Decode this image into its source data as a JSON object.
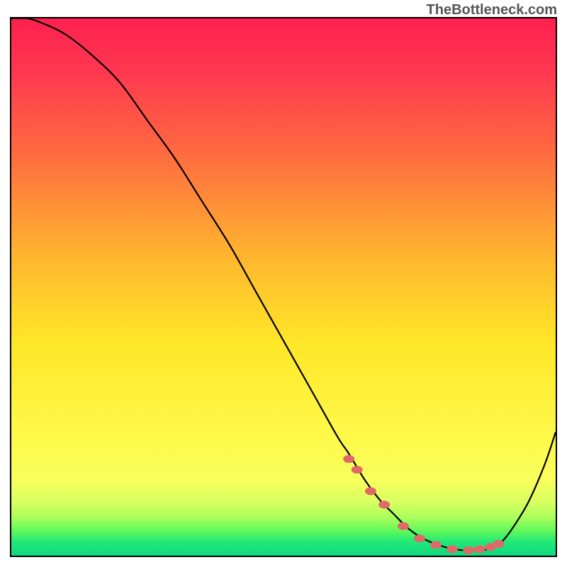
{
  "watermark": "TheBottleneck.com",
  "chart_data": {
    "type": "line",
    "title": "",
    "xlabel": "",
    "ylabel": "",
    "xlim": [
      0,
      100
    ],
    "ylim": [
      0,
      100
    ],
    "curve": {
      "x": [
        0,
        3,
        6,
        10,
        15,
        20,
        25,
        30,
        35,
        40,
        45,
        50,
        55,
        60,
        62,
        65,
        68,
        70,
        73,
        76,
        80,
        83,
        86,
        88,
        90,
        92,
        95,
        98,
        100
      ],
      "y": [
        100,
        100,
        99,
        97,
        93,
        88,
        81,
        74,
        66,
        58,
        49,
        40,
        31,
        22,
        19,
        14,
        10,
        8,
        5,
        3,
        1.5,
        1,
        1,
        1.3,
        2.5,
        5,
        10,
        17,
        23
      ]
    },
    "markers": {
      "x": [
        62,
        63.5,
        66,
        68.5,
        72,
        75,
        78,
        81,
        84,
        86,
        88,
        89.5
      ],
      "y": [
        18,
        16,
        12,
        9.5,
        5.5,
        3.2,
        2,
        1.2,
        1,
        1.2,
        1.6,
        2.2
      ]
    },
    "gradient_stops": [
      {
        "offset": 0,
        "color": "#ff2050"
      },
      {
        "offset": 0.1,
        "color": "#ff3850"
      },
      {
        "offset": 0.25,
        "color": "#ff6a40"
      },
      {
        "offset": 0.45,
        "color": "#ffb82e"
      },
      {
        "offset": 0.6,
        "color": "#ffe628"
      },
      {
        "offset": 0.78,
        "color": "#fff94a"
      },
      {
        "offset": 0.86,
        "color": "#f8ff5c"
      },
      {
        "offset": 0.9,
        "color": "#d8ff60"
      },
      {
        "offset": 0.93,
        "color": "#a8ff5c"
      },
      {
        "offset": 0.955,
        "color": "#5cf85c"
      },
      {
        "offset": 0.975,
        "color": "#20e878"
      },
      {
        "offset": 1.0,
        "color": "#10d880"
      }
    ],
    "marker_color": "#e06868",
    "curve_color": "#000000"
  }
}
